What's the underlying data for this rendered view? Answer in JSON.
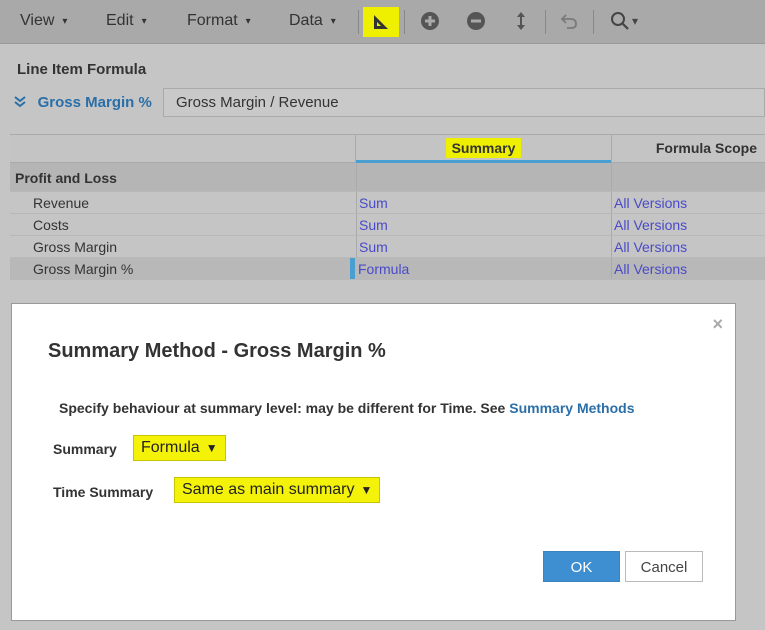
{
  "toolbar": {
    "menus": [
      {
        "label": "View"
      },
      {
        "label": "Edit"
      },
      {
        "label": "Format"
      },
      {
        "label": "Data"
      }
    ],
    "icons": [
      "set-square-icon",
      "plus-circle-icon",
      "minus-circle-icon",
      "up-down-arrow-icon",
      "undo-icon",
      "search-icon"
    ],
    "caret": "▾",
    "search_caret": "▾"
  },
  "formula_bar": {
    "title": "Line Item Formula",
    "line_item": "Gross Margin %",
    "formula": "Gross Margin / Revenue"
  },
  "grid": {
    "columns": {
      "summary": "Summary",
      "scope": "Formula Scope"
    },
    "group": "Profit and Loss",
    "rows": [
      {
        "label": "Revenue",
        "summary": "Sum",
        "scope": "All Versions"
      },
      {
        "label": "Costs",
        "summary": "Sum",
        "scope": "All Versions"
      },
      {
        "label": "Gross Margin",
        "summary": "Sum",
        "scope": "All Versions"
      },
      {
        "label": "Gross Margin %",
        "summary": "Formula",
        "scope": "All Versions"
      }
    ]
  },
  "dialog": {
    "title": "Summary Method - Gross Margin %",
    "description": "Specify behaviour at summary level: may be different for Time. See ",
    "description_link": "Summary Methods",
    "summary_label": "Summary",
    "summary_value": "Formula",
    "time_summary_label": "Time Summary",
    "time_summary_value": "Same as main summary",
    "ok_label": "OK",
    "cancel_label": "Cancel",
    "close_glyph": "×"
  },
  "colors": {
    "accent": "#3d8fd1",
    "highlight": "#eef000",
    "link": "#2a6fa8"
  }
}
